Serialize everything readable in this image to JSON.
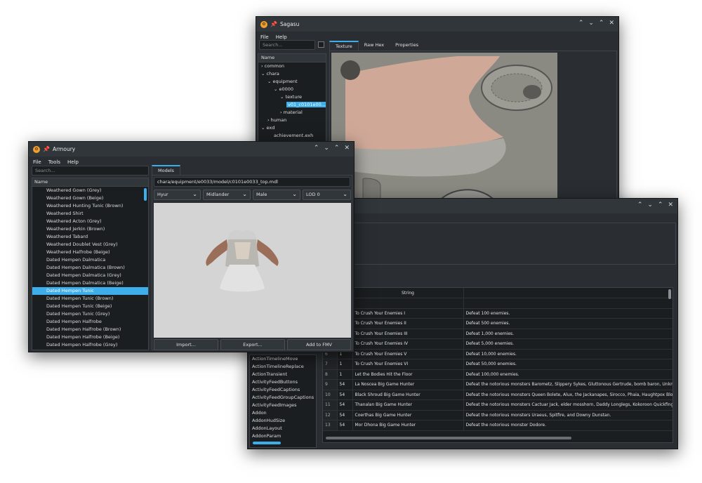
{
  "sagasu": {
    "title": "Sagasu",
    "menu": [
      "File",
      "Help"
    ],
    "search_placeholder": "Search...",
    "tree_header": "Name",
    "tree": [
      "common",
      "chara",
      "equipment",
      "e0000",
      "texture",
      "v01_c0101e00...",
      "material",
      "human",
      "exd",
      "achievement.exh"
    ],
    "tabs": [
      "Texture",
      "Raw Hex",
      "Properties"
    ]
  },
  "armoury": {
    "title": "Armoury",
    "menu": [
      "File",
      "Tools",
      "Help"
    ],
    "search_placeholder": "Search...",
    "list_header": "Name",
    "items": [
      "Weathered Gown (Grey)",
      "Weathered Gown (Beige)",
      "Weathered Hunting Tunic (Brown)",
      "Weathered Shirt",
      "Weathered Acton (Grey)",
      "Weathered Jerkin (Brown)",
      "Weathered Tabard",
      "Weathered Doublet Vest (Grey)",
      "Weathered Halfrobe (Beige)",
      "Dated Hempen Dalmatica",
      "Dated Hempen Dalmatica (Brown)",
      "Dated Hempen Dalmatica (Grey)",
      "Dated Hempen Dalmatica (Beige)",
      "Dated Hempen Tunic",
      "Dated Hempen Tunic (Brown)",
      "Dated Hempen Tunic (Beige)",
      "Dated Hempen Tunic (Grey)",
      "Dated Hempen Halfrobe",
      "Dated Hempen Halfrobe (Brown)",
      "Dated Hempen Halfrobe (Beige)",
      "Dated Hempen Halfrobe (Grey)"
    ],
    "selected_index": 13,
    "tab": "Models",
    "path": "chara/equipment/e0033/model/c0101e0033_top.mdl",
    "combos": [
      "Hyur",
      "Midlander",
      "Male",
      "LOD 0"
    ],
    "buttons": [
      "Import...",
      "Export...",
      "Add to FMV"
    ]
  },
  "exd": {
    "sheets": [
      "ActionTimelineMove",
      "ActionTimelineReplace",
      "ActionTransient",
      "ActivityFeedButtons",
      "ActivityFeedCaptions",
      "ActivityFeedGroupCaptions",
      "ActivityFeedImages",
      "Addon",
      "AddonHudSize",
      "AddonLayout",
      "AddonParam"
    ],
    "col_header": "String",
    "rows": [
      {
        "n": "",
        "a": "",
        "b": "To Crush Your Enemies I",
        "c": "Defeat 100 enemies."
      },
      {
        "n": "",
        "a": "",
        "b": "To Crush Your Enemies II",
        "c": "Defeat 500 enemies."
      },
      {
        "n": "",
        "a": "",
        "b": "To Crush Your Enemies III",
        "c": "Defeat 1,000 enemies."
      },
      {
        "n": "",
        "a": "",
        "b": "To Crush Your Enemies IV",
        "c": "Defeat 5,000 enemies."
      },
      {
        "n": "6",
        "a": "1",
        "b": "To Crush Your Enemies V",
        "c": "Defeat 10,000 enemies."
      },
      {
        "n": "7",
        "a": "1",
        "b": "To Crush Your Enemies VI",
        "c": "Defeat 50,000 enemies."
      },
      {
        "n": "8",
        "a": "1",
        "b": "Let the Bodies Hit the Floor",
        "c": "Defeat 100,000 enemies."
      },
      {
        "n": "9",
        "a": "54",
        "b": "La Noscea Big Game Hunter",
        "c": "Defeat the notorious monsters Barometz, Slippery Sykes, Gluttonous Gertrude, bomb baron, Unknown S"
      },
      {
        "n": "10",
        "a": "54",
        "b": "Black Shroud Big Game Hunter",
        "c": "Defeat the notorious monsters Queen Bolete, Alux, the Jackanapes, Sirocco, Phaia, Haughtpox Bloatbelly"
      },
      {
        "n": "11",
        "a": "54",
        "b": "Thanalan Big Game Hunter",
        "c": "Defeat the notorious monsters Cactuar Jack, elder mosshorn, Daddy Longlegs, Kokoroon Quickfingers, r"
      },
      {
        "n": "12",
        "a": "54",
        "b": "Coerthas Big Game Hunter",
        "c": "Defeat the notorious monsters Uraeus, Spitfire, and Downy Dunstan."
      },
      {
        "n": "13",
        "a": "54",
        "b": "Mor Dhona Big Game Hunter",
        "c": "Defeat the notorious monster Dodore."
      }
    ]
  }
}
